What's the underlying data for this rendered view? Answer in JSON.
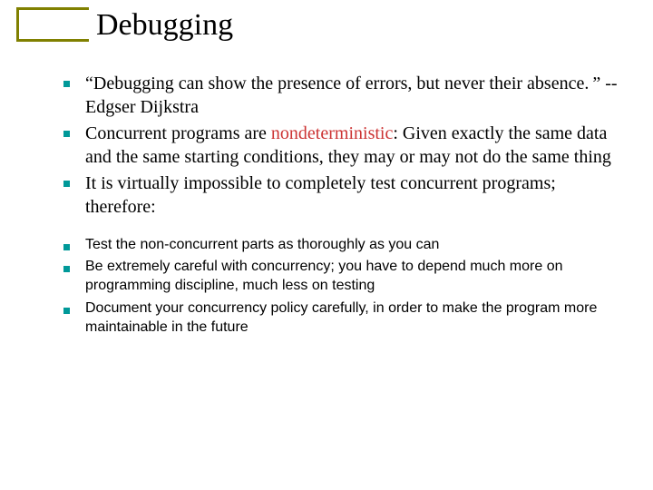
{
  "title": "Debugging",
  "bullets": {
    "b1_a": "“Debugging can show the presence of errors, but never their absence. ”  -- Edgser Dijkstra",
    "b2_a": "Concurrent programs are ",
    "b2_nd": "nondeterministic",
    "b2_b": ": Given exactly the same data and the same starting conditions, they may or may not do the same thing",
    "b3": "It is virtually impossible to completely test concurrent programs; therefore:"
  },
  "subs": {
    "s1": "Test the non-concurrent parts as thoroughly as you can",
    "s2": "Be extremely careful with concurrency; you have to depend much more on programming discipline, much less on testing",
    "s3": "Document your concurrency policy carefully, in order to make the program more maintainable in the future"
  }
}
